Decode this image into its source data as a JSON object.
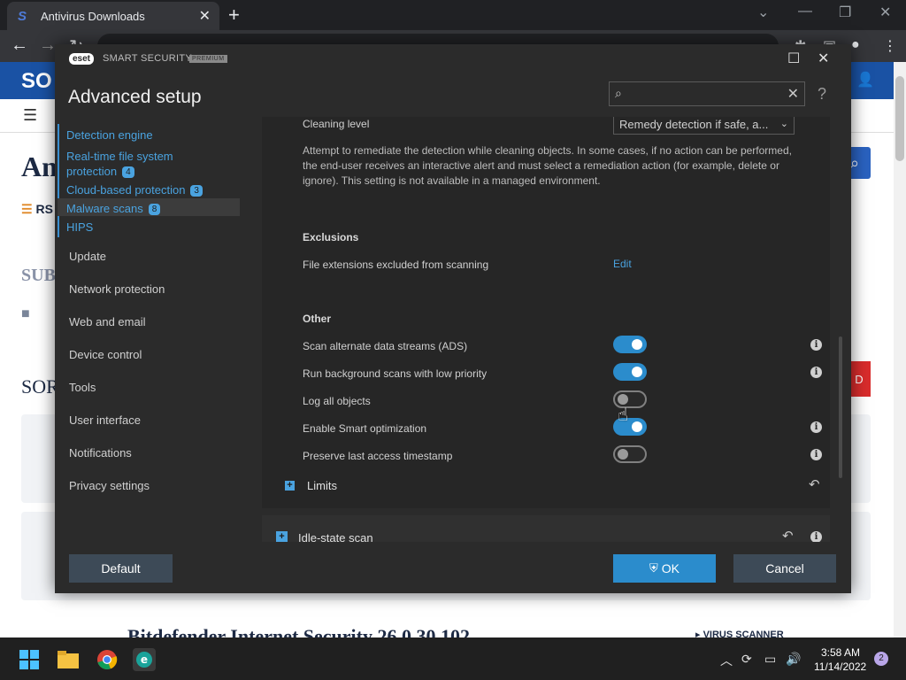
{
  "browser": {
    "tab_title": "Antivirus Downloads",
    "tab_close": "✕",
    "new_tab": "+",
    "omnibox_text": ""
  },
  "website": {
    "logo": "SO",
    "title_fragment": "An",
    "rss_fragment": "RS",
    "sub_fragment": "SUB",
    "sor_fragment": "SOR",
    "red_fragment": "D",
    "bottom_title": "Bitdefender Internet Security 26.0.30.102",
    "bottom_tag": "VIRUS SCANNER"
  },
  "eset": {
    "logo_text": "eset",
    "product": "SMART SECURITY",
    "premium": "PREMIUM",
    "heading": "Advanced setup",
    "search_placeholder": "",
    "help": "?",
    "sidebar_sub": [
      {
        "label": "Detection engine"
      },
      {
        "label": "Real-time file system",
        "label2": "protection",
        "badge": "4"
      },
      {
        "label": "Cloud-based protection",
        "badge": "3"
      },
      {
        "label": "Malware scans",
        "badge": "8"
      },
      {
        "label": "HIPS"
      }
    ],
    "sidebar_top": [
      "Update",
      "Network protection",
      "Web and email",
      "Device control",
      "Tools",
      "User interface",
      "Notifications",
      "Privacy settings"
    ],
    "cleaning_level_label": "Cleaning level",
    "cleaning_level_value": "Remedy detection if safe, a...",
    "description": "Attempt to remediate the detection while cleaning objects. In some cases, if no action can be performed, the end-user receives an interactive alert and must select a remediation action (for example, delete or ignore). This setting is not available in a managed environment.",
    "exclusions_heading": "Exclusions",
    "exclusions_label": "File extensions excluded from scanning",
    "edit_label": "Edit",
    "other_heading": "Other",
    "other_options": [
      {
        "label": "Scan alternate data streams (ADS)",
        "enabled": true,
        "info": true
      },
      {
        "label": "Run background scans with low priority",
        "enabled": true,
        "info": true
      },
      {
        "label": "Log all objects",
        "enabled": false,
        "info": false
      },
      {
        "label": "Enable Smart optimization",
        "enabled": true,
        "info": true
      },
      {
        "label": "Preserve last access timestamp",
        "enabled": false,
        "info": true
      }
    ],
    "limits_label": "Limits",
    "idle_label": "Idle-state scan",
    "buttons": {
      "default": "Default",
      "ok": "OK",
      "cancel": "Cancel"
    },
    "colors": {
      "accent": "#2b8ccc",
      "link": "#4aa3e0",
      "background": "#2b2b2b"
    }
  },
  "taskbar": {
    "time": "3:58 AM",
    "date": "11/14/2022",
    "notifications": "2"
  }
}
